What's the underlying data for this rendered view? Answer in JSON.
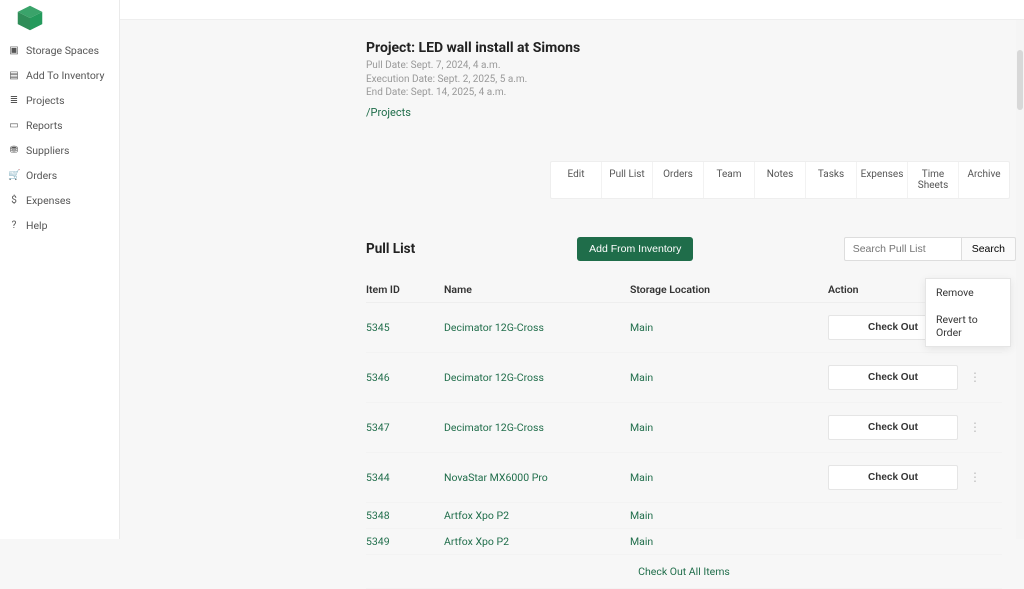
{
  "sidebar": {
    "items": [
      {
        "icon": "▣",
        "label": "Storage Spaces"
      },
      {
        "icon": "▤",
        "label": "Add To Inventory"
      },
      {
        "icon": "≣",
        "label": "Projects"
      },
      {
        "icon": "▭",
        "label": "Reports"
      },
      {
        "icon": "⛃",
        "label": "Suppliers"
      },
      {
        "icon": "🛒",
        "label": "Orders"
      },
      {
        "icon": "$",
        "label": "Expenses"
      },
      {
        "icon": "?",
        "label": "Help"
      }
    ]
  },
  "project": {
    "title": "Project: LED wall install at Simons",
    "pull_date": "Pull Date: Sept. 7, 2024, 4 a.m.",
    "exec_date": "Execution Date: Sept. 2, 2025, 5 a.m.",
    "end_date": "End Date: Sept. 14, 2025, 4 a.m.",
    "breadcrumb": "/Projects"
  },
  "tabs": [
    "Edit",
    "Pull List",
    "Orders",
    "Team",
    "Notes",
    "Tasks",
    "Expenses",
    "Time Sheets",
    "Archive"
  ],
  "pull_list": {
    "section_title": "Pull List",
    "add_button": "Add From Inventory",
    "search_placeholder": "Search Pull List",
    "search_button": "Search",
    "columns": {
      "item_id": "Item ID",
      "name": "Name",
      "storage": "Storage Location",
      "action": "Action"
    },
    "checkout_label": "Check Out",
    "rows": [
      {
        "id": "5345",
        "name": "Decimator 12G-Cross",
        "loc": "Main",
        "has_action": true
      },
      {
        "id": "5346",
        "name": "Decimator 12G-Cross",
        "loc": "Main",
        "has_action": true
      },
      {
        "id": "5347",
        "name": "Decimator 12G-Cross",
        "loc": "Main",
        "has_action": true
      },
      {
        "id": "5344",
        "name": "NovaStar MX6000 Pro",
        "loc": "Main",
        "has_action": true
      },
      {
        "id": "5348",
        "name": "Artfox Xpo P2",
        "loc": "Main",
        "has_action": false
      },
      {
        "id": "5349",
        "name": "Artfox Xpo P2",
        "loc": "Main",
        "has_action": false
      }
    ],
    "all_items": "Check Out All Items"
  },
  "context_menu": {
    "remove": "Remove",
    "revert": "Revert to Order"
  }
}
